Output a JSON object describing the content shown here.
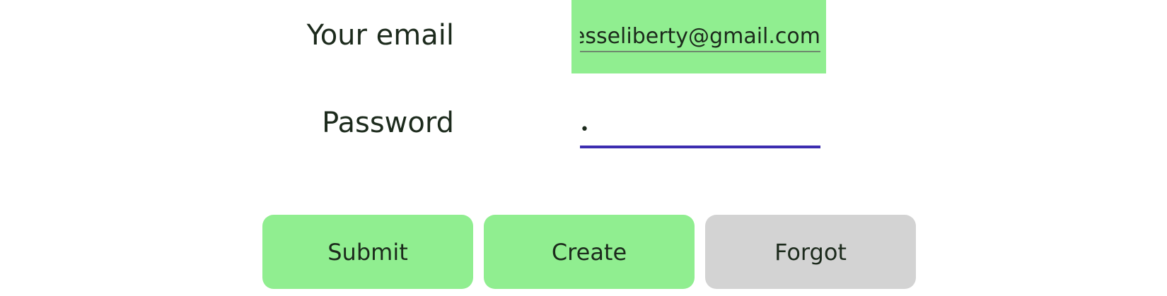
{
  "form": {
    "email_label": "Your email",
    "email_value": "jesseliberty@gmail.com",
    "password_label": "Password",
    "password_value": "•"
  },
  "buttons": {
    "submit_label": "Submit",
    "create_label": "Create",
    "forgot_label": "Forgot"
  },
  "colors": {
    "green_background": "#90ee90",
    "gray_background": "#d3d3d3",
    "password_underline": "#3c2db0",
    "text": "#1c2a1c"
  }
}
